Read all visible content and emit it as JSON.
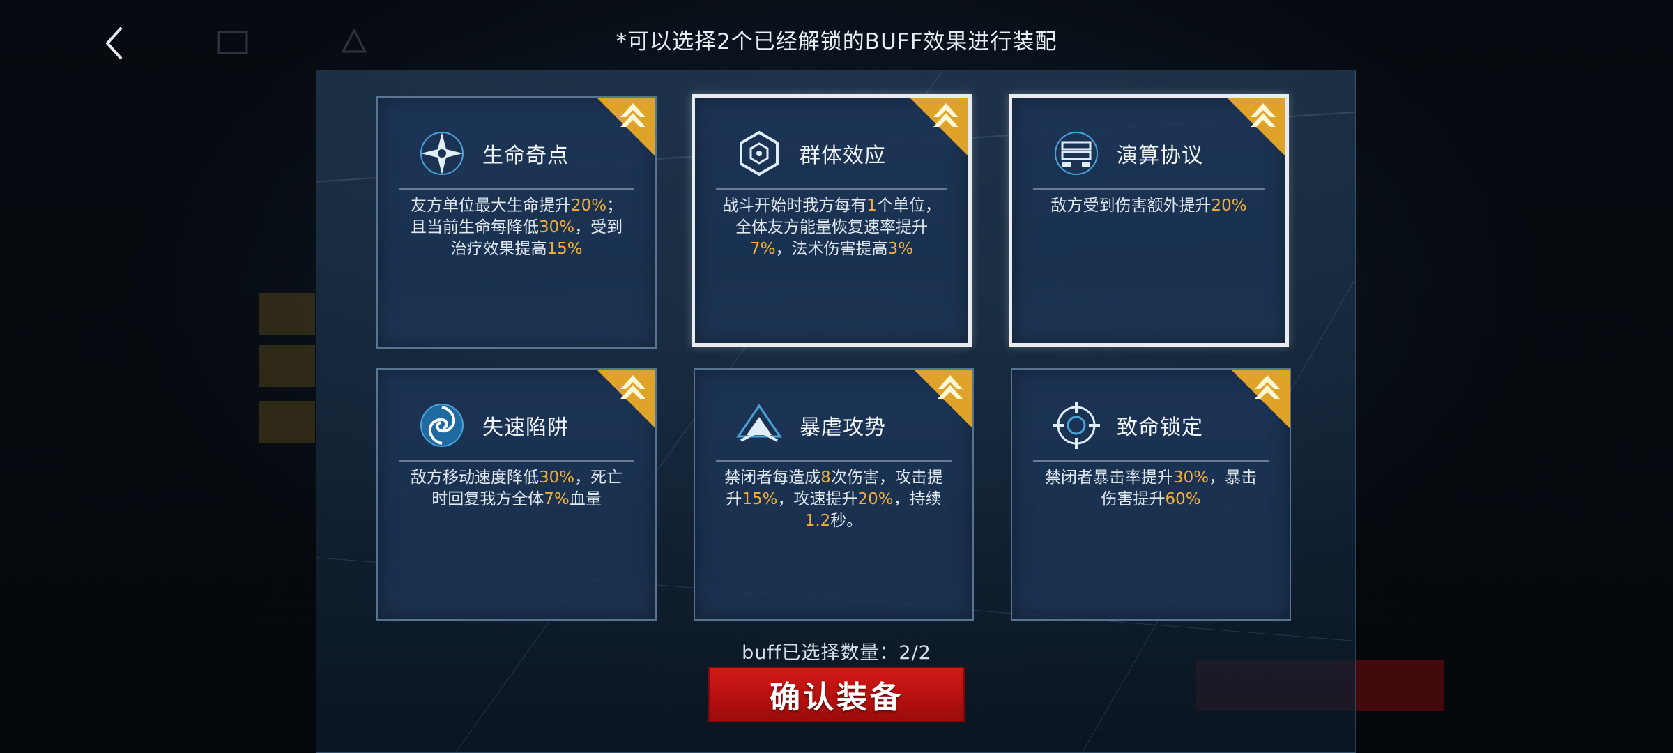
{
  "nav": {
    "back_icon": "chevron-left-icon"
  },
  "hint": "*可以选择2个已经解锁的BUFF效果进行装配",
  "cards": [
    {
      "title": "生命奇点",
      "icon": "star-burst-icon",
      "selected": false,
      "desc": [
        [
          {
            "t": "友方单位最大生命提升"
          },
          {
            "t": "20%",
            "h": true
          },
          {
            "t": "；"
          }
        ],
        [
          {
            "t": "且当前生命每降低"
          },
          {
            "t": "30%",
            "h": true
          },
          {
            "t": "，受到"
          }
        ],
        [
          {
            "t": "治疗效果提高"
          },
          {
            "t": "15%",
            "h": true
          }
        ]
      ]
    },
    {
      "title": "群体效应",
      "icon": "hexagon-core-icon",
      "selected": true,
      "desc": [
        [
          {
            "t": "战斗开始时我方每有"
          },
          {
            "t": "1",
            "h": true
          },
          {
            "t": "个单位，"
          }
        ],
        [
          {
            "t": "全体友方能量恢复速率提升"
          }
        ],
        [
          {
            "t": "7%",
            "h": true
          },
          {
            "t": "，法术伤害提高"
          },
          {
            "t": "3%",
            "h": true
          }
        ]
      ]
    },
    {
      "title": "演算协议",
      "icon": "server-icon",
      "selected": true,
      "desc": [
        [
          {
            "t": "敌方受到伤害额外提升"
          },
          {
            "t": "20%",
            "h": true
          }
        ]
      ]
    },
    {
      "title": "失速陷阱",
      "icon": "vortex-icon",
      "selected": false,
      "desc": [
        [
          {
            "t": "敌方移动速度降低"
          },
          {
            "t": "30%",
            "h": true
          },
          {
            "t": "，死亡"
          }
        ],
        [
          {
            "t": "时回复我方全体"
          },
          {
            "t": "7%",
            "h": true
          },
          {
            "t": "血量"
          }
        ]
      ]
    },
    {
      "title": "暴虐攻势",
      "icon": "chevron-emblem-icon",
      "selected": false,
      "desc": [
        [
          {
            "t": "禁闭者每造成"
          },
          {
            "t": "8",
            "h": true
          },
          {
            "t": "次伤害，攻击提"
          }
        ],
        [
          {
            "t": "升"
          },
          {
            "t": "15%",
            "h": true
          },
          {
            "t": "，攻速提升"
          },
          {
            "t": "20%",
            "h": true
          },
          {
            "t": "，持续"
          }
        ],
        [
          {
            "t": "1.2",
            "h": true
          },
          {
            "t": "秒。"
          }
        ]
      ]
    },
    {
      "title": "致命锁定",
      "icon": "crosshair-icon",
      "selected": false,
      "desc": [
        [
          {
            "t": "禁闭者暴击率提升"
          },
          {
            "t": "30%",
            "h": true
          },
          {
            "t": "，暴击"
          }
        ],
        [
          {
            "t": "伤害提升"
          },
          {
            "t": "60%",
            "h": true
          }
        ]
      ]
    }
  ],
  "selection_count": "buff已选择数量：2/2",
  "confirm_label": "确认装备",
  "colors": {
    "highlight": "#f3b03a",
    "confirm": "#c3141a",
    "rank_badge": "#e0a32a"
  }
}
